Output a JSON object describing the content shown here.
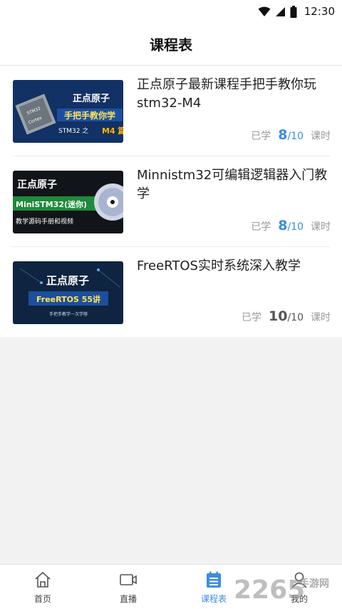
{
  "status_bar": {
    "time": "12:30",
    "icons": [
      "wifi-icon",
      "signal-icon",
      "battery-icon"
    ]
  },
  "header": {
    "title": "课程表"
  },
  "colors": {
    "accent": "#3a8de0",
    "text_primary": "#222222",
    "text_muted": "#9a9a9a",
    "background": "#f2f2f2"
  },
  "courses": [
    {
      "title": "正点原子最新课程手把手教你玩stm32-M4",
      "learned_label": "已学",
      "learned": "8",
      "total": "/10",
      "unit_label": "课时",
      "progress_fraction": 0.8,
      "thumb": {
        "brand": "正点原子",
        "subtitle": "手把手教你学",
        "line3_prefix": "STM32 之 ",
        "line3_highlight": "M4 篇",
        "chip_line1": "STM32",
        "chip_line2": "Cortex"
      }
    },
    {
      "title": "Minnistm32可编辑逻辑器入门教学",
      "learned_label": "已学",
      "learned": "8",
      "total": "/10",
      "unit_label": "课时",
      "progress_fraction": 0.8,
      "thumb": {
        "brand": "正点原子",
        "subtitle": "MiniSTM32(迷你)",
        "line3": "教学源码手册和视频"
      }
    },
    {
      "title": "FreeRTOS实时系统深入教学",
      "learned_label": "已学",
      "learned": "10",
      "total": "/10",
      "unit_label": "课时",
      "progress_fraction": 1.0,
      "thumb": {
        "brand": "正点原子",
        "subtitle": "FreeRTOS 55讲",
        "line3": "手把手教学一次学够"
      }
    }
  ],
  "bottom_nav": [
    {
      "label": "首页",
      "icon": "home-icon"
    },
    {
      "label": "直播",
      "icon": "video-camera-icon"
    },
    {
      "label": "课程表",
      "icon": "schedule-icon",
      "active": true
    },
    {
      "label": "我的",
      "icon": "profile-icon"
    }
  ],
  "watermark": {
    "number": "2265",
    "text": "手游网"
  }
}
